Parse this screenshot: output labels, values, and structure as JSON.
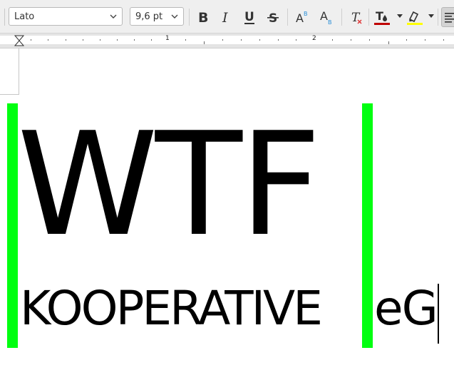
{
  "toolbar": {
    "font_name": "Lato",
    "font_size": "9,6 pt",
    "font_color": "#c00000",
    "highlight_color": "#ffff00",
    "buttons": {
      "bold": "bold-icon",
      "italic": "italic-icon",
      "underline": "underline-icon",
      "strikethrough": "strikethrough-icon",
      "superscript": "superscript-icon",
      "subscript": "subscript-icon",
      "clear_formatting": "clear-formatting-icon",
      "font_color": "font-color-icon",
      "highlight": "highlight-icon",
      "align_left": "align-left-icon"
    }
  },
  "ruler": {
    "labels": [
      "1",
      "2"
    ]
  },
  "document": {
    "line1": "WTF",
    "line2_part1": "KOOPERATIVE",
    "line2_part2": "eG",
    "marker_color": "#00ff10"
  }
}
